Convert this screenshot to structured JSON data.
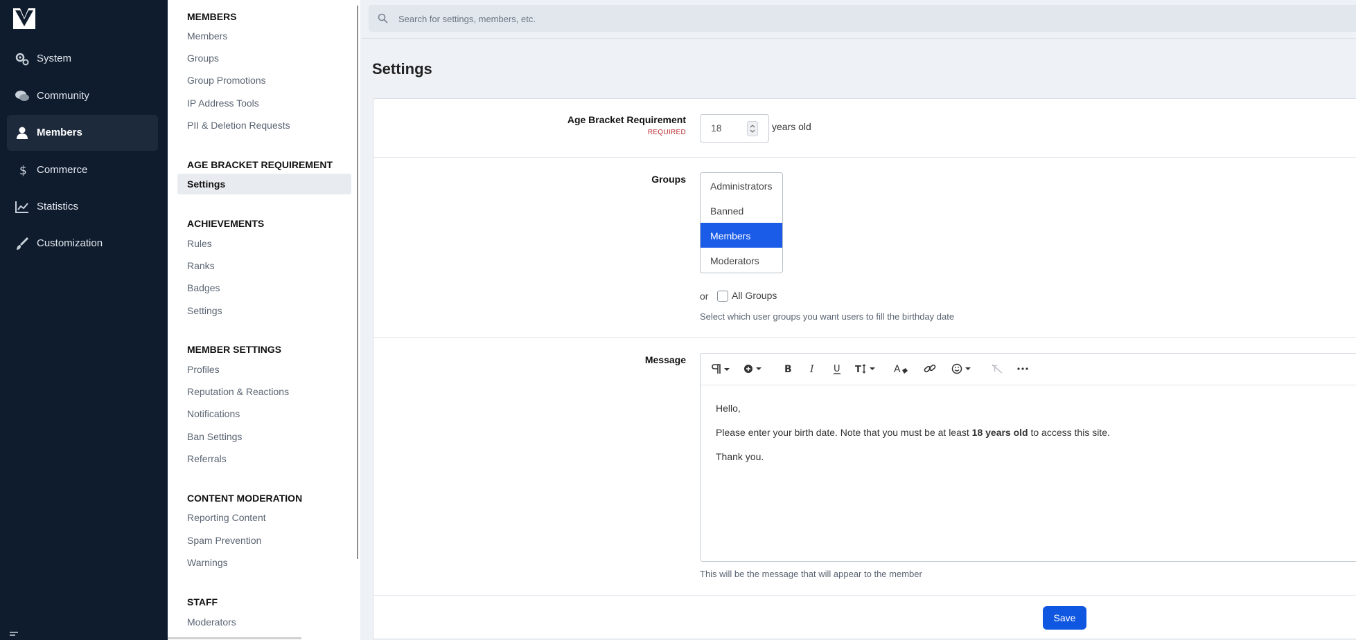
{
  "nav": {
    "items": [
      {
        "label": "System",
        "icon": "gears-icon"
      },
      {
        "label": "Community",
        "icon": "comments-icon"
      },
      {
        "label": "Members",
        "icon": "user-icon",
        "active": true
      },
      {
        "label": "Commerce",
        "icon": "dollar-icon"
      },
      {
        "label": "Statistics",
        "icon": "chart-line-icon"
      },
      {
        "label": "Customization",
        "icon": "brush-icon"
      }
    ]
  },
  "subnav": {
    "members": {
      "title": "MEMBERS",
      "items": [
        "Members",
        "Groups",
        "Group Promotions",
        "IP Address Tools",
        "PII & Deletion Requests"
      ]
    },
    "age": {
      "title": "AGE BRACKET REQUIREMENT",
      "items": [
        "Settings"
      ]
    },
    "achievements": {
      "title": "ACHIEVEMENTS",
      "items": [
        "Rules",
        "Ranks",
        "Badges",
        "Settings"
      ]
    },
    "member_settings": {
      "title": "MEMBER SETTINGS",
      "items": [
        "Profiles",
        "Reputation & Reactions",
        "Notifications",
        "Ban Settings",
        "Referrals"
      ]
    },
    "moderation": {
      "title": "CONTENT MODERATION",
      "items": [
        "Reporting Content",
        "Spam Prevention",
        "Warnings"
      ]
    },
    "staff": {
      "title": "STAFF",
      "items": [
        "Moderators"
      ]
    }
  },
  "search": {
    "placeholder": "Search for settings, members, etc."
  },
  "page_title": "Settings",
  "form": {
    "age": {
      "label": "Age Bracket Requirement",
      "required": "REQUIRED",
      "value": "18",
      "suffix": "years old"
    },
    "groups": {
      "label": "Groups",
      "options": [
        "Administrators",
        "Banned",
        "Members",
        "Moderators"
      ],
      "selected": "Members",
      "or": "or",
      "all_label": "All Groups",
      "hint": "Select which user groups you want users to fill the birthday date"
    },
    "message": {
      "label": "Message",
      "line1": "Hello,",
      "line2_pre": "Please enter your birth date. Note that you must be at least",
      "line2_bold": "18 years old",
      "line2_post": "to access this site.",
      "line3": "Thank you.",
      "hint": "This will be the message that will appear to the member"
    },
    "save": "Save"
  },
  "colors": {
    "nav_bg": "#0f1c2e",
    "accent": "#1a5ce8",
    "required": "#b8262c"
  }
}
